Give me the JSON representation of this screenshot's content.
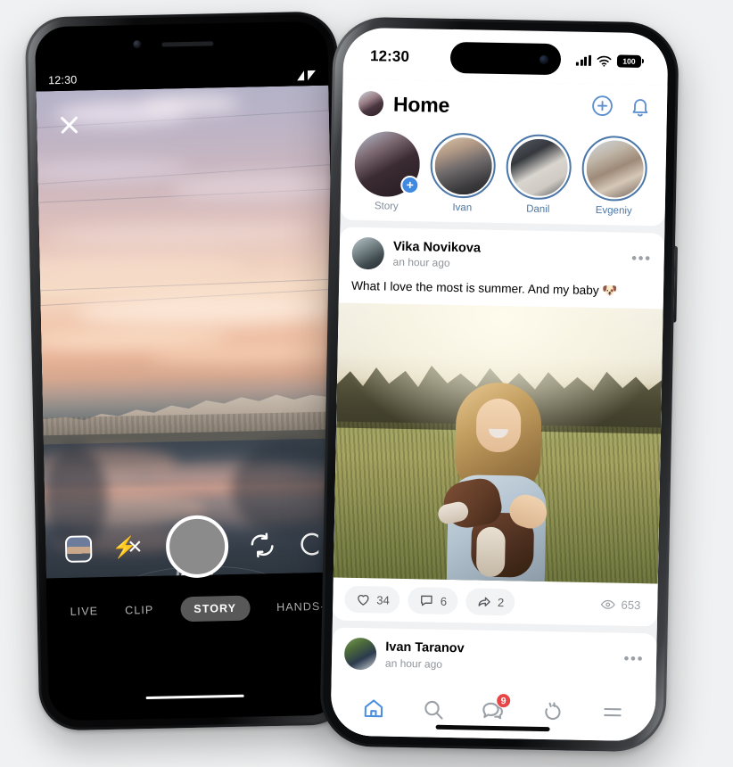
{
  "android": {
    "status": {
      "time": "12:30",
      "signal_icon": "signal-triangles-icon"
    },
    "story_camera": {
      "close_icon": "close-icon",
      "controls": {
        "gallery_label": "gallery-thumbnail",
        "flash_label": "flash-off-icon",
        "shutter_label": "shutter-button",
        "flip_label": "flip-camera-icon",
        "extra_label": "more-effects-icon"
      },
      "modes": [
        {
          "label": "LIVE",
          "active": false
        },
        {
          "label": "CLIP",
          "active": false
        },
        {
          "label": "STORY",
          "active": true
        },
        {
          "label": "HANDS-FREE",
          "active": false
        }
      ]
    }
  },
  "iphone": {
    "status": {
      "time": "12:30",
      "battery": "100",
      "wifi_icon": "wifi-icon",
      "cellular_icon": "cellular-bars-icon"
    },
    "header": {
      "title": "Home",
      "avatar_name": "user-avatar",
      "add_icon": "plus-circle-icon",
      "bell_icon": "bell-icon"
    },
    "stories": [
      {
        "name": "Story",
        "ring": false,
        "badge": "+",
        "muted": true
      },
      {
        "name": "Ivan",
        "ring": true,
        "badge": "",
        "muted": false
      },
      {
        "name": "Danil",
        "ring": true,
        "badge": "",
        "muted": false
      },
      {
        "name": "Evgeniy",
        "ring": true,
        "badge": "",
        "muted": false
      }
    ],
    "posts": [
      {
        "author": "Vika Novikova",
        "time": "an hour ago",
        "text": "What I love the most is summer. And my baby 🐶",
        "menu_icon": "more-options-icon",
        "likes": "34",
        "comments": "6",
        "shares": "2",
        "views": "653",
        "like_icon": "heart-icon",
        "comment_icon": "comment-icon",
        "share_icon": "share-icon",
        "views_icon": "eye-icon"
      },
      {
        "author": "Ivan Taranov",
        "time": "an hour ago",
        "menu_icon": "more-options-icon"
      }
    ],
    "tabbar": [
      {
        "name": "home",
        "icon": "home-icon",
        "active": true,
        "badge": ""
      },
      {
        "name": "search",
        "icon": "search-icon",
        "active": false,
        "badge": ""
      },
      {
        "name": "messages",
        "icon": "chat-bubble-icon",
        "active": false,
        "badge": "9"
      },
      {
        "name": "clips",
        "icon": "clips-icon",
        "active": false,
        "badge": ""
      },
      {
        "name": "menu",
        "icon": "hamburger-menu-icon",
        "active": false,
        "badge": ""
      }
    ]
  },
  "colors": {
    "accent": "#4a76a8",
    "accent_bright": "#3f8ae0",
    "badge_red": "#e64646",
    "page_bg": "#f0f1f2",
    "muted_text": "#818c99"
  }
}
